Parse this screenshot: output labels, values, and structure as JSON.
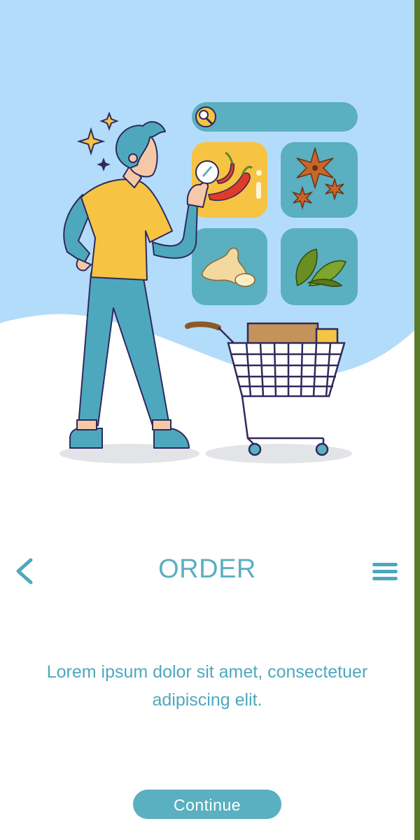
{
  "hero": {
    "background_color": "#b3dcfb",
    "illustration": "man-shopping-spices-with-cart",
    "search_icon": "search-icon",
    "tiles": [
      "chili-pepper",
      "star-anise",
      "ginger",
      "bay-leaf"
    ]
  },
  "nav": {
    "back_icon": "chevron-left-icon",
    "title": "ORDER",
    "menu_icon": "hamburger-menu-icon"
  },
  "description": "Lorem ipsum dolor sit amet, consectetuer adipiscing elit.",
  "continue_label": "Continue",
  "colors": {
    "accent": "#5aafc0",
    "text": "#4ea8bd",
    "sky": "#b3dcfb",
    "right_edge": "#5a7b28"
  }
}
